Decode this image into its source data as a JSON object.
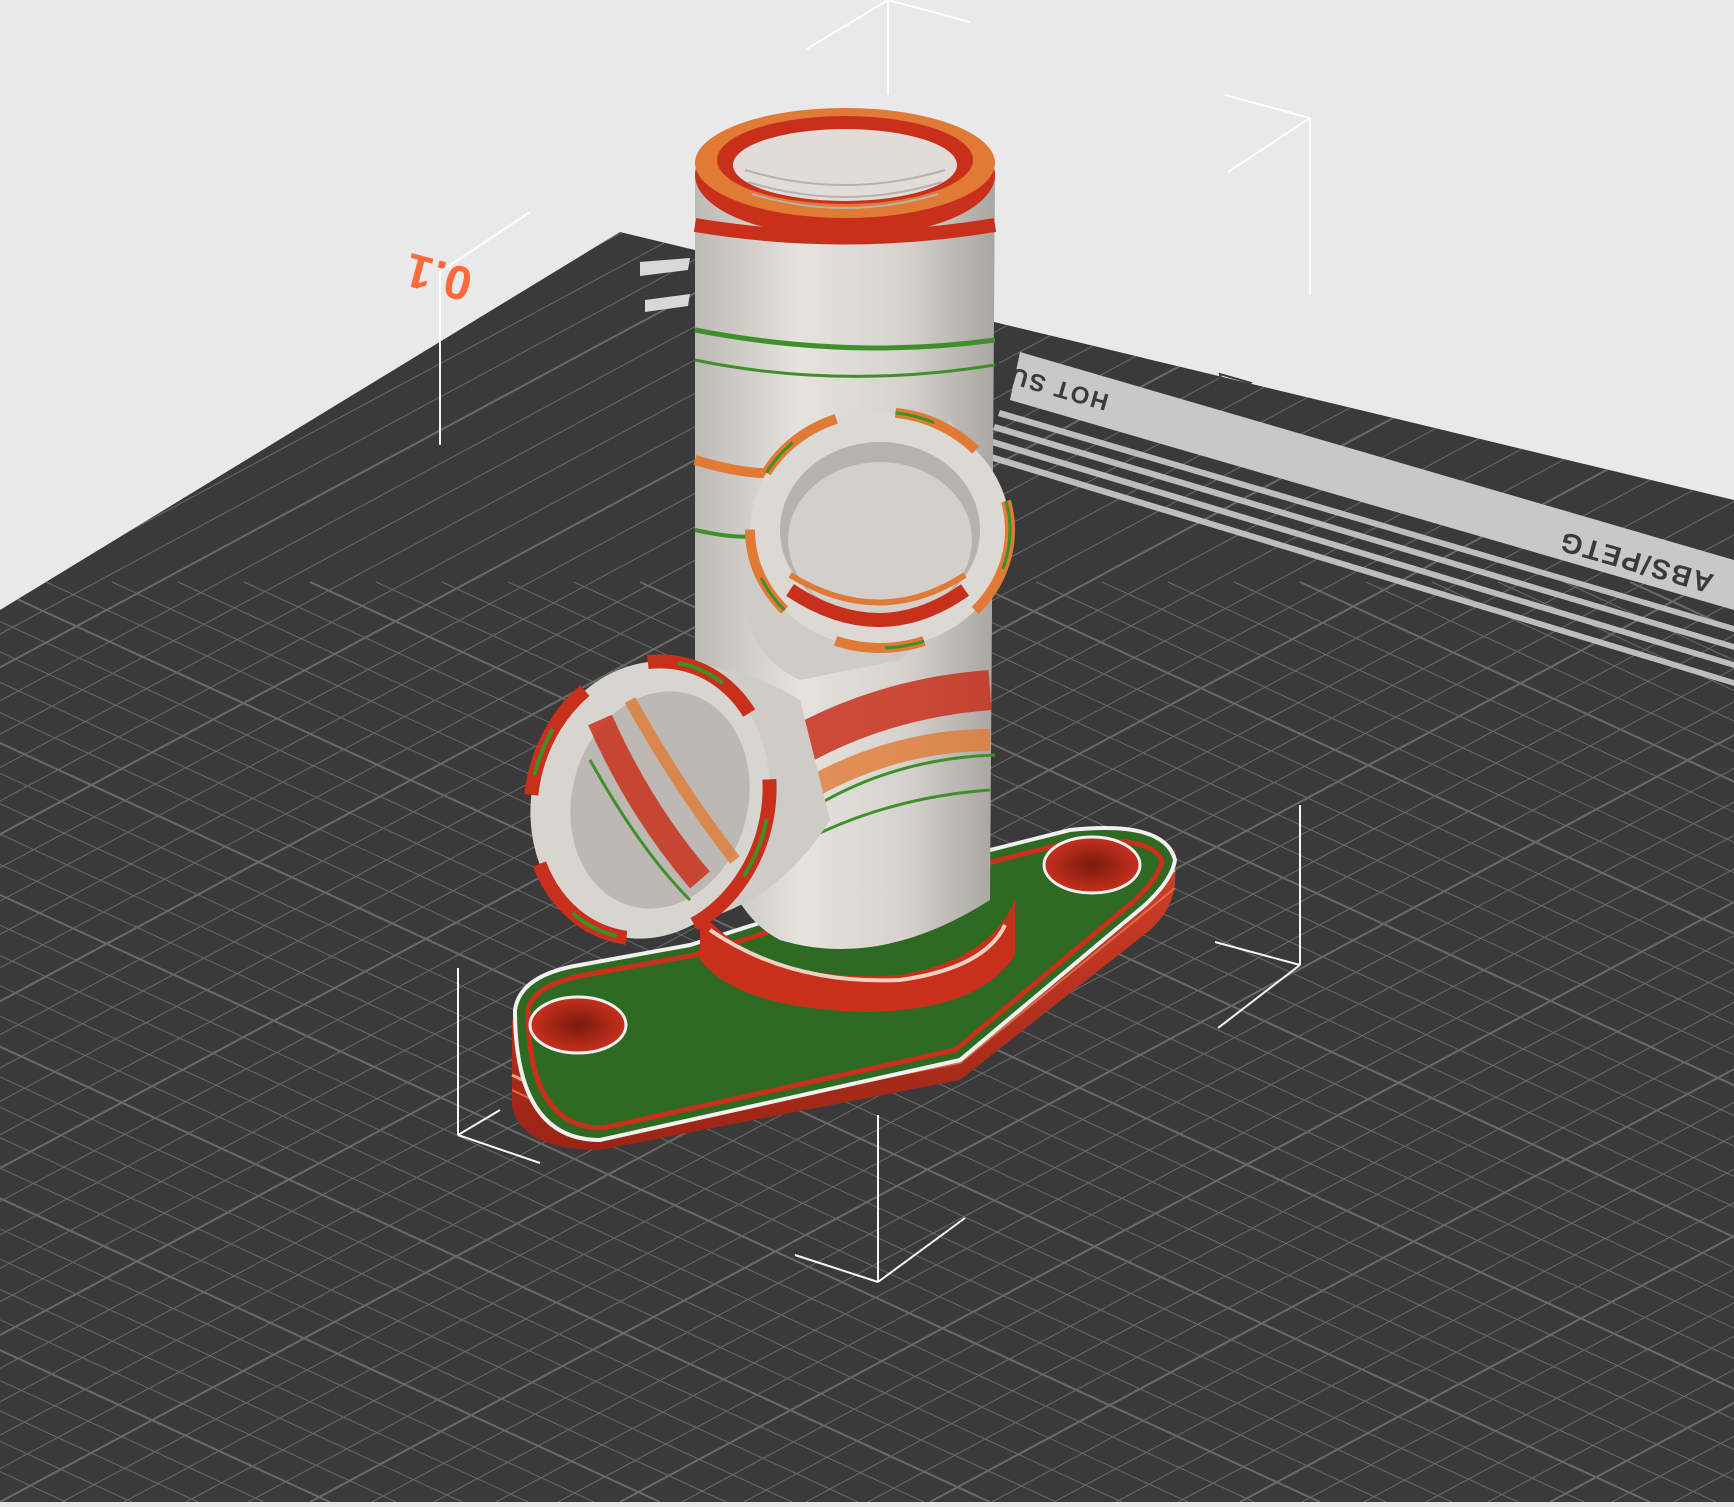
{
  "scene": {
    "background_color": "#e9e9e9",
    "bed_color": "#3a3a3a",
    "grid_color": "#6a6a6a",
    "bed_strip_color": "#c8c8c8",
    "accent_color": "#ff6a3d"
  },
  "bed": {
    "origin_label": "0.1",
    "warning_text": "HOT SURFACE",
    "material_label": "ABS/PETG"
  },
  "model": {
    "name": "flanged-tee-fitting",
    "overlay": "overhang/quality heatmap",
    "colors": {
      "surface": "#d9d6d2",
      "hot": "#c8301c",
      "warm": "#e07a35",
      "ok": "#3f8f2a",
      "base_top": "#2e6a22"
    }
  }
}
